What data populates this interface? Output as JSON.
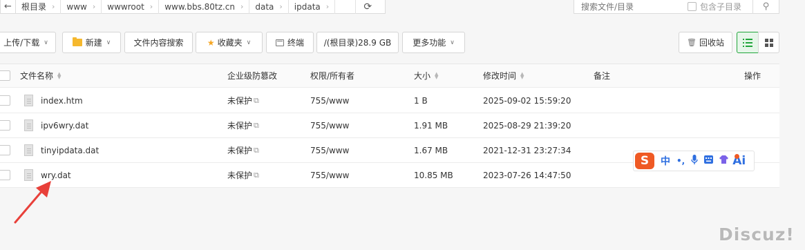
{
  "pathbar": {
    "back_icon": "back-arrow-icon",
    "crumbs": [
      "根目录",
      "www",
      "wwwroot",
      "www.bbs.80tz.cn",
      "data",
      "ipdata"
    ],
    "refresh_icon": "refresh-icon"
  },
  "search": {
    "placeholder": "搜索文件/目录",
    "include_sub_label": "包含子目录",
    "search_icon": "search-icon"
  },
  "toolbar": {
    "upload_label": "上传/下载",
    "new_label": "新建",
    "content_search_label": "文件内容搜索",
    "favorites_label": "收藏夹",
    "terminal_label": "终端",
    "disk_label": "/(根目录)28.9 GB",
    "more_label": "更多功能",
    "recycle_label": "回收站"
  },
  "table": {
    "headers": {
      "name": "文件名称",
      "protect": "企业级防篡改",
      "perm": "权限/所有者",
      "size": "大小",
      "mtime": "修改时间",
      "note": "备注",
      "action": "操作"
    },
    "rows": [
      {
        "name": "index.htm",
        "protect": "未保护",
        "perm": "755/www",
        "size": "1 B",
        "mtime": "2025-09-02 15:59:20"
      },
      {
        "name": "ipv6wry.dat",
        "protect": "未保护",
        "perm": "755/www",
        "size": "1.91 MB",
        "mtime": "2025-08-29 21:39:20"
      },
      {
        "name": "tinyipdata.dat",
        "protect": "未保护",
        "perm": "755/www",
        "size": "1.67 MB",
        "mtime": "2021-12-31 23:27:34"
      },
      {
        "name": "wry.dat",
        "protect": "未保护",
        "perm": "755/www",
        "size": "10.85 MB",
        "mtime": "2023-07-26 14:47:50"
      }
    ]
  },
  "ime": {
    "logo": "S",
    "lang": "中",
    "punct": "•,",
    "ai": "Ai"
  },
  "watermark": "Discuz!",
  "colors": {
    "accent": "#20a53a",
    "folder": "#f5b82e",
    "arrow": "#e8403a",
    "ime_brand": "#ef5a24"
  }
}
